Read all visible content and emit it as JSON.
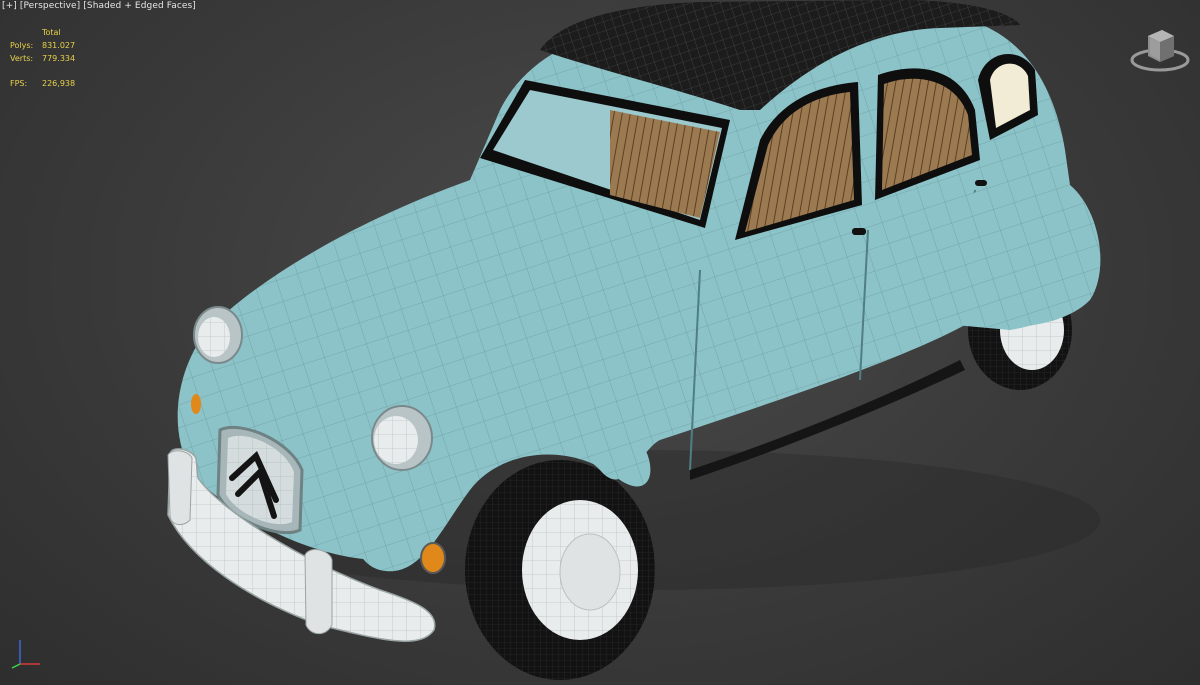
{
  "viewport": {
    "labels": {
      "plus": "[+]",
      "view": "[Perspective]",
      "shading": "[Shaded + Edged Faces]"
    },
    "stats": {
      "header": "Total",
      "polys_label": "Polys:",
      "polys_value": "831.027",
      "verts_label": "Verts:",
      "verts_value": "779.334",
      "fps_label": "FPS:",
      "fps_value": "226,938"
    },
    "colors": {
      "body": "#8cc3c8",
      "roof": "#1c1c1c",
      "stats_text": "#e8d24a",
      "label_text": "#e6e6e6",
      "background": "#3a3a3a"
    },
    "icons": [
      "viewcube-icon",
      "axis-tripod-icon"
    ]
  }
}
